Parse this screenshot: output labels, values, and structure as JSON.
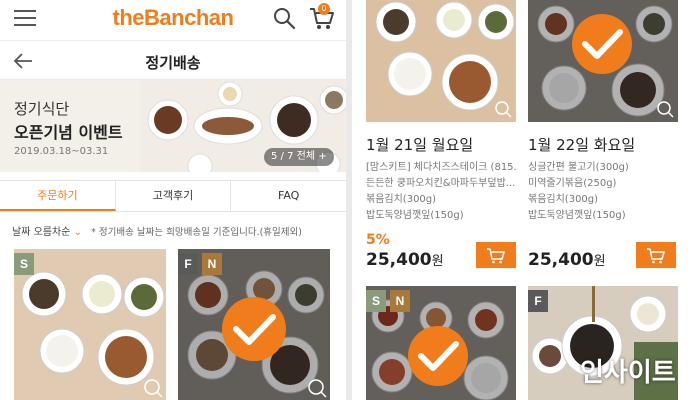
{
  "colors": {
    "accent": "#f07c1b",
    "badge_gray": "#8a9a7b",
    "badge_brown": "#a9793b"
  },
  "header": {
    "logo": "theBanchan",
    "cart_count": "0",
    "menu_icon": "hamburger-icon",
    "search_icon": "search-icon",
    "cart_icon": "cart-icon"
  },
  "subheader": {
    "title": "정기배송",
    "back_icon": "arrow-left-icon"
  },
  "banner": {
    "title_line1": "정기식단",
    "title_line2": "오픈기념 이벤트",
    "date_range": "2019.03.18~03.31",
    "indicator": "5 / 7 전체 +"
  },
  "tabs": [
    {
      "label": "주문하기",
      "active": true
    },
    {
      "label": "고객후기",
      "active": false
    },
    {
      "label": "FAQ",
      "active": false
    }
  ],
  "sort": {
    "selected": "날짜 오름차순",
    "note": "* 정기배송 날짜는 희망배송일 기준입니다.(휴일제외)"
  },
  "left_cards": [
    {
      "badges": [
        "S"
      ],
      "selected": false
    },
    {
      "badges": [
        "F",
        "N"
      ],
      "selected": true
    }
  ],
  "right_products": [
    {
      "date": "1월 21일 월요일",
      "menu": [
        "[맘스키트] 체다치즈스테이크 (815...",
        "든든한 쿵파오치킨&마파두부덮밥...",
        "볶음김치(300g)",
        "밥도둑양념깻잎(150g)"
      ],
      "discount": "5%",
      "price": "25,400",
      "currency": "원",
      "selected": false
    },
    {
      "date": "1월 22일 화요일",
      "menu": [
        "싱글간편 불고기(300g)",
        "미역줄기볶음(250g)",
        "볶음김치(300g)",
        "밥도둑양념깻잎(150g)"
      ],
      "discount": "",
      "price": "25,400",
      "currency": "원",
      "selected": true
    }
  ],
  "right_bottom_cards": [
    {
      "badges": [
        "S",
        "N"
      ],
      "selected": true
    },
    {
      "badges": [
        "F"
      ],
      "selected": false
    }
  ],
  "watermark": "인사이트"
}
